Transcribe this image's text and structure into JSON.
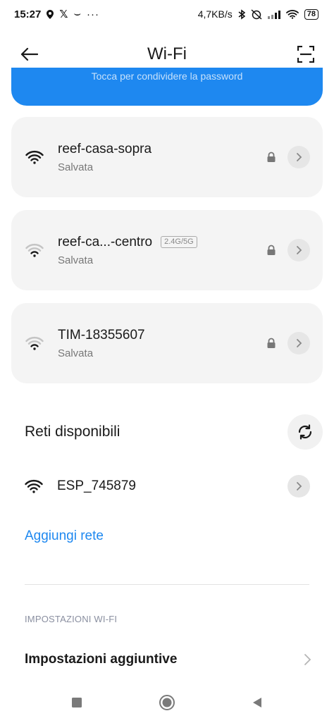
{
  "status_bar": {
    "time": "15:27",
    "data_speed": "4,7KB/s",
    "battery": "78",
    "left_icons": [
      "location-icon",
      "x-app-icon",
      "tilde-icon",
      "more-dots-icon"
    ],
    "right_icons": [
      "bluetooth-icon",
      "alarm-off-icon",
      "signal-icon",
      "wifi-icon",
      "battery-icon"
    ]
  },
  "header": {
    "title": "Wi-Fi"
  },
  "banner": {
    "text": "Tocca per condividere la password"
  },
  "saved_networks": [
    {
      "name": "reef-casa-sopra",
      "status": "Salvata",
      "band": "",
      "signal": "strong"
    },
    {
      "name": "reef-ca...-centro",
      "status": "Salvata",
      "band": "2.4G/5G",
      "signal": "weak"
    },
    {
      "name": "TIM-18355607",
      "status": "Salvata",
      "band": "",
      "signal": "weak"
    }
  ],
  "available": {
    "title": "Reti disponibili",
    "networks": [
      {
        "name": "ESP_745879",
        "signal": "strong"
      }
    ]
  },
  "add_network_label": "Aggiungi rete",
  "settings": {
    "section_label": "IMPOSTAZIONI WI-FI",
    "row_label": "Impostazioni aggiuntive"
  },
  "colors": {
    "accent": "#1e88f0",
    "card_bg": "#f4f4f4",
    "secondary_text": "#777777"
  }
}
